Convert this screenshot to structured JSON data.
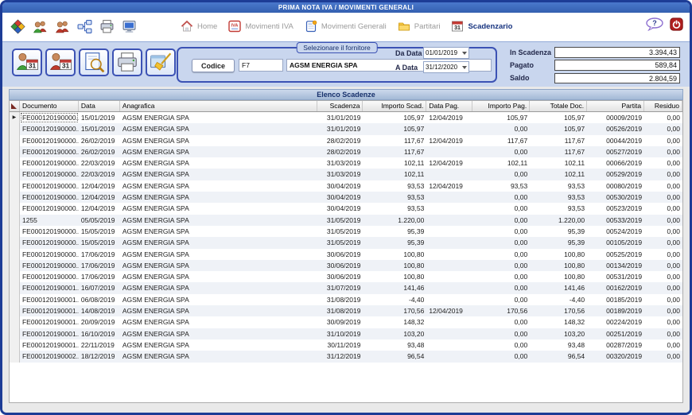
{
  "window": {
    "title": "PRIMA NOTA IVA / MOVIMENTI GENERALI"
  },
  "toolbar": {
    "icons": [
      "cube-icon",
      "users-green-icon",
      "users-red-icon",
      "org-chart-icon",
      "printer-icon",
      "monitor-icon"
    ]
  },
  "nav": {
    "items": [
      {
        "label": "Home",
        "icon": "home-icon",
        "active": false
      },
      {
        "label": "Movimenti IVA",
        "icon": "iva-icon",
        "active": false
      },
      {
        "label": "Movimenti Generali",
        "icon": "document-icon",
        "active": false
      },
      {
        "label": "Partitari",
        "icon": "folder-icon",
        "active": false
      },
      {
        "label": "Scadenzario",
        "icon": "calendar-31-icon",
        "active": true
      }
    ],
    "help_icon": "help-bubble-icon",
    "power_icon": "power-icon"
  },
  "filter": {
    "buttons": [
      "customer-schedule-button",
      "supplier-schedule-button",
      "preview-button",
      "print-button",
      "clear-button"
    ],
    "group_title": "Selezionare il fornitore",
    "codice_label": "Codice",
    "codice_value": "F7",
    "fornitore_value": "AGSM ENERGIA SPA",
    "da_data_label": "Da Data",
    "da_data_value": "01/01/2019",
    "a_data_label": "A Data",
    "a_data_value": "31/12/2020",
    "totals": [
      {
        "label": "In Scadenza",
        "value": "3.394,43"
      },
      {
        "label": "Pagato",
        "value": "589,84"
      },
      {
        "label": "Saldo",
        "value": "2.804,59"
      }
    ]
  },
  "table": {
    "section_title": "Elenco Scadenze",
    "columns": [
      "Documento",
      "Data",
      "Anagrafica",
      "Scadenza",
      "Importo Scad.",
      "Data Pag.",
      "Importo Pag.",
      "Totale Doc.",
      "Partita",
      "Residuo"
    ],
    "rows": [
      [
        "FE000120190000...",
        "15/01/2019",
        "AGSM ENERGIA SPA",
        "31/01/2019",
        "105,97",
        "12/04/2019",
        "105,97",
        "105,97",
        "00009/2019",
        "0,00"
      ],
      [
        "FE000120190000...",
        "15/01/2019",
        "AGSM ENERGIA SPA",
        "31/01/2019",
        "105,97",
        "",
        "0,00",
        "105,97",
        "00526/2019",
        "0,00"
      ],
      [
        "FE000120190000...",
        "26/02/2019",
        "AGSM ENERGIA SPA",
        "28/02/2019",
        "117,67",
        "12/04/2019",
        "117,67",
        "117,67",
        "00044/2019",
        "0,00"
      ],
      [
        "FE000120190000...",
        "26/02/2019",
        "AGSM ENERGIA SPA",
        "28/02/2019",
        "117,67",
        "",
        "0,00",
        "117,67",
        "00527/2019",
        "0,00"
      ],
      [
        "FE000120190000...",
        "22/03/2019",
        "AGSM ENERGIA SPA",
        "31/03/2019",
        "102,11",
        "12/04/2019",
        "102,11",
        "102,11",
        "00066/2019",
        "0,00"
      ],
      [
        "FE000120190000...",
        "22/03/2019",
        "AGSM ENERGIA SPA",
        "31/03/2019",
        "102,11",
        "",
        "0,00",
        "102,11",
        "00529/2019",
        "0,00"
      ],
      [
        "FE000120190000...",
        "12/04/2019",
        "AGSM ENERGIA SPA",
        "30/04/2019",
        "93,53",
        "12/04/2019",
        "93,53",
        "93,53",
        "00080/2019",
        "0,00"
      ],
      [
        "FE000120190000...",
        "12/04/2019",
        "AGSM ENERGIA SPA",
        "30/04/2019",
        "93,53",
        "",
        "0,00",
        "93,53",
        "00530/2019",
        "0,00"
      ],
      [
        "FE000120190000...",
        "12/04/2019",
        "AGSM ENERGIA SPA",
        "30/04/2019",
        "93,53",
        "",
        "0,00",
        "93,53",
        "00523/2019",
        "0,00"
      ],
      [
        "1255",
        "05/05/2019",
        "AGSM ENERGIA SPA",
        "31/05/2019",
        "1.220,00",
        "",
        "0,00",
        "1.220,00",
        "00533/2019",
        "0,00"
      ],
      [
        "FE000120190000...",
        "15/05/2019",
        "AGSM ENERGIA SPA",
        "31/05/2019",
        "95,39",
        "",
        "0,00",
        "95,39",
        "00524/2019",
        "0,00"
      ],
      [
        "FE000120190000...",
        "15/05/2019",
        "AGSM ENERGIA SPA",
        "31/05/2019",
        "95,39",
        "",
        "0,00",
        "95,39",
        "00105/2019",
        "0,00"
      ],
      [
        "FE000120190000...",
        "17/06/2019",
        "AGSM ENERGIA SPA",
        "30/06/2019",
        "100,80",
        "",
        "0,00",
        "100,80",
        "00525/2019",
        "0,00"
      ],
      [
        "FE000120190000...",
        "17/06/2019",
        "AGSM ENERGIA SPA",
        "30/06/2019",
        "100,80",
        "",
        "0,00",
        "100,80",
        "00134/2019",
        "0,00"
      ],
      [
        "FE000120190000...",
        "17/06/2019",
        "AGSM ENERGIA SPA",
        "30/06/2019",
        "100,80",
        "",
        "0,00",
        "100,80",
        "00531/2019",
        "0,00"
      ],
      [
        "FE000120190001...",
        "16/07/2019",
        "AGSM ENERGIA SPA",
        "31/07/2019",
        "141,46",
        "",
        "0,00",
        "141,46",
        "00162/2019",
        "0,00"
      ],
      [
        "FE000120190001...",
        "06/08/2019",
        "AGSM ENERGIA SPA",
        "31/08/2019",
        "-4,40",
        "",
        "0,00",
        "-4,40",
        "00185/2019",
        "0,00"
      ],
      [
        "FE000120190001...",
        "14/08/2019",
        "AGSM ENERGIA SPA",
        "31/08/2019",
        "170,56",
        "12/04/2019",
        "170,56",
        "170,56",
        "00189/2019",
        "0,00"
      ],
      [
        "FE000120190001...",
        "20/09/2019",
        "AGSM ENERGIA SPA",
        "30/09/2019",
        "148,32",
        "",
        "0,00",
        "148,32",
        "00224/2019",
        "0,00"
      ],
      [
        "FE000120190001...",
        "16/10/2019",
        "AGSM ENERGIA SPA",
        "31/10/2019",
        "103,20",
        "",
        "0,00",
        "103,20",
        "00251/2019",
        "0,00"
      ],
      [
        "FE000120190001...",
        "22/11/2019",
        "AGSM ENERGIA SPA",
        "30/11/2019",
        "93,48",
        "",
        "0,00",
        "93,48",
        "00287/2019",
        "0,00"
      ],
      [
        "FE000120190002...",
        "18/12/2019",
        "AGSM ENERGIA SPA",
        "31/12/2019",
        "96,54",
        "",
        "0,00",
        "96,54",
        "00320/2019",
        "0,00"
      ]
    ]
  },
  "colors": {
    "window_border": "#1d3c96",
    "titlebar": "#3f6cbd",
    "panel": "#c9d6ee",
    "band_text": "#17306b",
    "active_nav": "#16337f",
    "accent_border": "#3c52b4",
    "row_alt": "#eff2f7"
  }
}
